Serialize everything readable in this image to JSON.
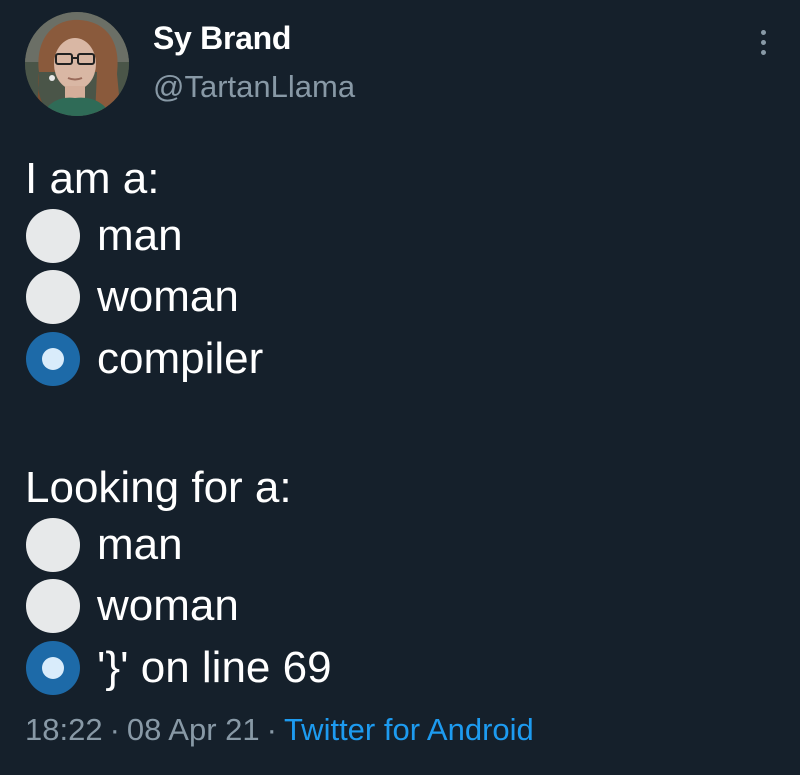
{
  "author": {
    "display_name": "Sy Brand",
    "handle": "@TartanLlama",
    "avatar_icon": "profile-photo"
  },
  "more_icon": "more-vertical-icon",
  "sections": [
    {
      "heading": "I am a:",
      "options": [
        {
          "label": "man",
          "selected": false
        },
        {
          "label": "woman",
          "selected": false
        },
        {
          "label": "compiler",
          "selected": true
        }
      ]
    },
    {
      "heading": "Looking for a:",
      "options": [
        {
          "label": "man",
          "selected": false
        },
        {
          "label": "woman",
          "selected": false
        },
        {
          "label": "'}' on line 69",
          "selected": true
        }
      ]
    }
  ],
  "meta": {
    "time": "18:22",
    "separator": "·",
    "date": "08 Apr 21",
    "source": "Twitter for Android"
  },
  "colors": {
    "background": "#15202b",
    "secondary_text": "#8899a6",
    "link": "#1d9bf0",
    "radio_selected": "#1d6aa8",
    "radio_unselected": "#e7e9ea"
  }
}
